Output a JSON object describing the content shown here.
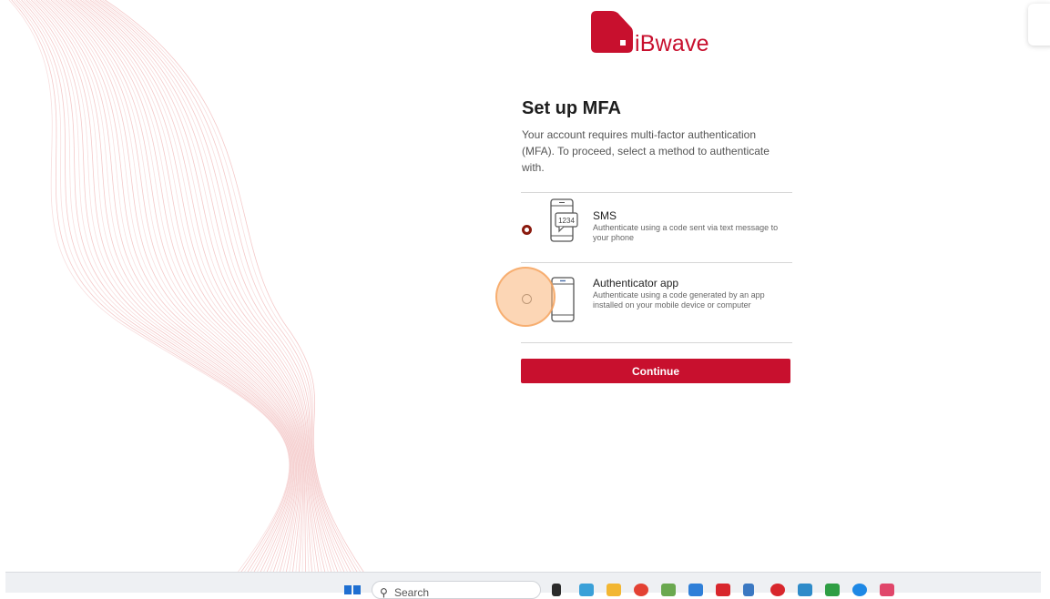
{
  "brand": {
    "name": "iBwave",
    "color": "#c8102e"
  },
  "mfa": {
    "title": "Set up MFA",
    "description": "Your account requires multi-factor authentication (MFA). To proceed, select a method to authenticate with.",
    "options": [
      {
        "title": "SMS",
        "description": "Authenticate using a code sent via text message to your phone",
        "icon": "sms-phone-icon",
        "icon_text": "1234",
        "selected": true
      },
      {
        "title": "Authenticator app",
        "description": "Authenticate using a code generated by an app installed on your mobile device or computer",
        "icon": "mobile-phone-icon",
        "selected": false
      }
    ],
    "continue_label": "Continue"
  },
  "taskbar": {
    "search_label": "Search",
    "icons": [
      "windows-start-icon",
      "search-icon",
      "task-view-icon",
      "copilot-icon",
      "file-explorer-icon",
      "chrome-icon",
      "teams-icon",
      "outlook-icon",
      "flipboard-icon",
      "calculator-icon",
      "app-icon",
      "app-icon",
      "app-icon",
      "edge-icon",
      "app-icon"
    ]
  },
  "colors": {
    "accent": "#c8102e",
    "radio_selected": "#8a1a0e",
    "click_highlight": "#f5a05a"
  }
}
